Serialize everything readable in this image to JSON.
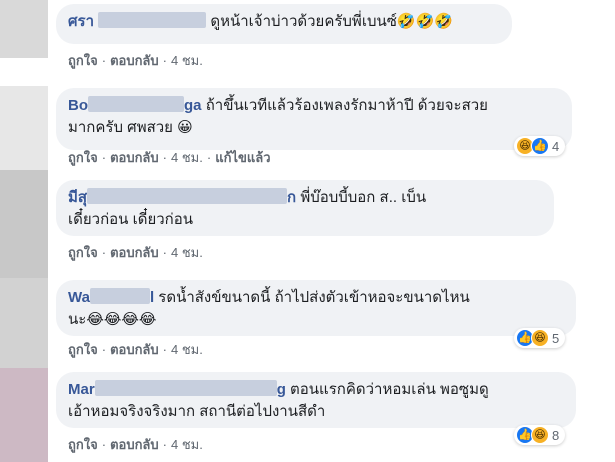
{
  "comments": [
    {
      "author_visible": "ศรา",
      "author_tail": "",
      "lines": [
        "ดูหน้าเจ้าบ่าวด้วยครับพี่เบนซ์"
      ],
      "emoji_tail": "🤣🤣🤣",
      "actions": {
        "like": "ถูกใจ",
        "reply": "ตอบกลับ",
        "time": "4 ชม.",
        "edited": ""
      },
      "reaction_count": ""
    },
    {
      "author_visible": "Bo",
      "author_tail": "ga",
      "lines": [
        "ถ้าขึ้นเวทีแล้วร้องเพลงรักมาห้าปี ด้วยจะสวย",
        "มากครับ ศพสวย"
      ],
      "emoji_tail": "😀",
      "actions": {
        "like": "ถูกใจ",
        "reply": "ตอบกลับ",
        "time": "4 ชม.",
        "edited": "แก้ไขแล้ว"
      },
      "reaction_count": "4"
    },
    {
      "author_visible": "มีสุ",
      "author_tail": "ก",
      "lines": [
        "พี่บ๊อบบี้บอก ส.. เบ็น",
        "เดี๋ยวก่อน เดี๋ยวก่อน"
      ],
      "emoji_tail": "",
      "actions": {
        "like": "ถูกใจ",
        "reply": "ตอบกลับ",
        "time": "4 ชม.",
        "edited": ""
      },
      "reaction_count": ""
    },
    {
      "author_visible": "Wa",
      "author_tail": "l",
      "lines": [
        "รดน้ำสังข์ขนาดนี้ ถ้าไปส่งตัวเข้าหอจะขนาดไหน",
        "นะ"
      ],
      "emoji_tail": "😂😂😂😂",
      "actions": {
        "like": "ถูกใจ",
        "reply": "ตอบกลับ",
        "time": "4 ชม.",
        "edited": ""
      },
      "reaction_count": "5"
    },
    {
      "author_visible": "Mar",
      "author_tail": "g",
      "lines": [
        "ตอนแรกคิดว่าหอมเล่น พอซูมดู",
        "เอ้าหอมจริงจริงมาก สถานีต่อไปงานสีดำ"
      ],
      "emoji_tail": "",
      "actions": {
        "like": "ถูกใจ",
        "reply": "ตอบกลับ",
        "time": "4 ชม.",
        "edited": ""
      },
      "reaction_count": "8"
    }
  ],
  "reaction_icons": [
    "like-icon",
    "haha-icon"
  ],
  "colors": {
    "bubble": "#f0f2f5",
    "author": "#385898",
    "meta": "#606770",
    "like": "#1877f2",
    "haha": "#f7b125"
  }
}
